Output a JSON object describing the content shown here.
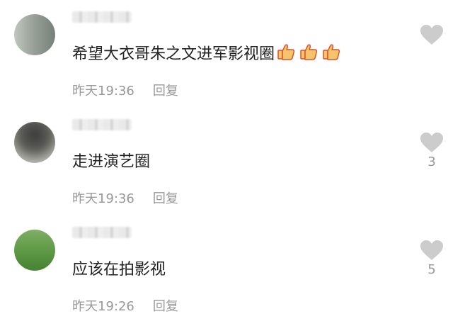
{
  "comments": [
    {
      "text": "希望大衣哥朱之文进军影视圈",
      "emoji": [
        "thumbs-up",
        "thumbs-up",
        "thumbs-up"
      ],
      "time": "昨天19:36",
      "reply_label": "回复",
      "likes": ""
    },
    {
      "text": "走进演艺圈",
      "time": "昨天19:36",
      "reply_label": "回复",
      "likes": "3"
    },
    {
      "text": "应该在拍影视",
      "time": "昨天19:26",
      "reply_label": "回复",
      "likes": "5"
    }
  ],
  "colors": {
    "text": "#222222",
    "meta": "#999999",
    "like_icon": "#cccccc",
    "thumb_fill": "#f7c46c",
    "thumb_border": "#d9532b"
  },
  "icons": {
    "like": "heart-icon",
    "emoji": "thumbs-up-icon"
  }
}
